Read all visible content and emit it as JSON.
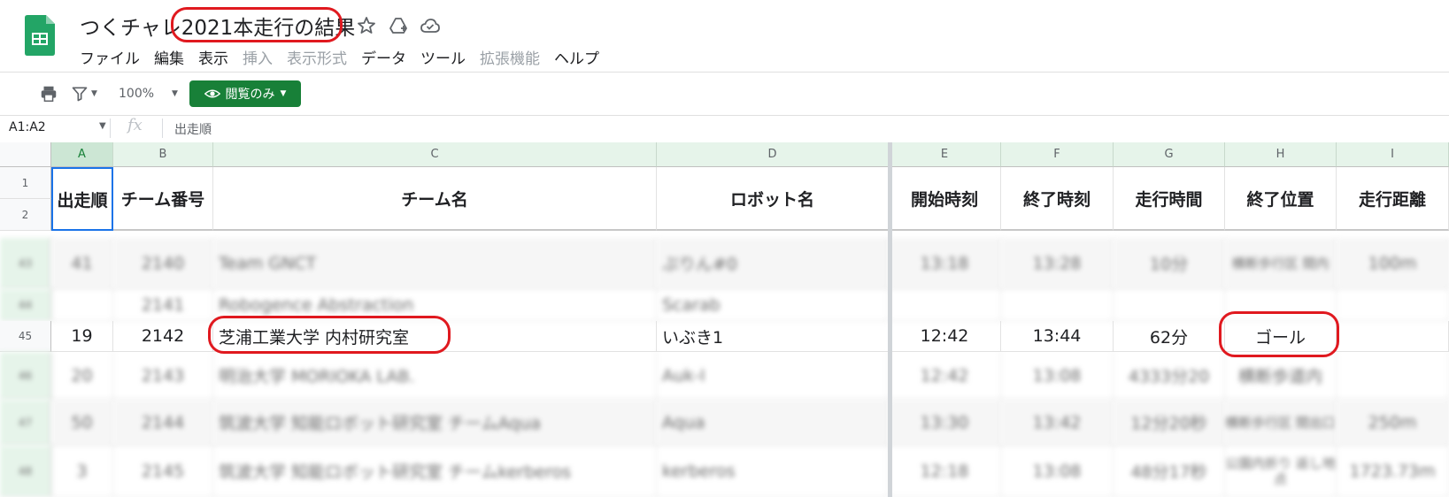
{
  "app": {
    "doc_title": "つくチャレ2021本走行の結果",
    "menu": [
      {
        "label": "ファイル",
        "enabled": true
      },
      {
        "label": "編集",
        "enabled": true
      },
      {
        "label": "表示",
        "enabled": true
      },
      {
        "label": "挿入",
        "enabled": false
      },
      {
        "label": "表示形式",
        "enabled": false
      },
      {
        "label": "データ",
        "enabled": true
      },
      {
        "label": "ツール",
        "enabled": true
      },
      {
        "label": "拡張機能",
        "enabled": false
      },
      {
        "label": "ヘルプ",
        "enabled": true
      }
    ]
  },
  "toolbar": {
    "zoom": "100%",
    "view_mode_label": "閲覧のみ"
  },
  "formula_bar": {
    "name_box": "A1:A2",
    "value": "出走順"
  },
  "grid": {
    "columns": [
      "A",
      "B",
      "C",
      "D",
      "E",
      "F",
      "G",
      "H",
      "I"
    ],
    "header_row_numbers": [
      "1",
      "2"
    ],
    "headers": [
      "出走順",
      "チーム番号",
      "チーム名",
      "ロボット名",
      "開始時刻",
      "終了時刻",
      "走行時間",
      "終了位置",
      "走行距離"
    ],
    "rows": [
      {
        "num": "43",
        "cells": [
          "41",
          "2140",
          "Team GNCT",
          "ぷりん#0",
          "13:18",
          "13:28",
          "10分",
          "横断歩行区 間内",
          "100m"
        ]
      },
      {
        "num": "44",
        "cells": [
          "",
          "2141",
          "Robogence Abstraction",
          "Scarab",
          "",
          "",
          "",
          "",
          ""
        ]
      },
      {
        "num": "45",
        "cells": [
          "19",
          "2142",
          "芝浦工業大学 内村研究室",
          "いぶき1",
          "12:42",
          "13:44",
          "62分",
          "ゴール",
          ""
        ]
      },
      {
        "num": "46",
        "cells": [
          "20",
          "2143",
          "明治大学 MORIOKA LAB.",
          "Auk-I",
          "12:42",
          "13:08",
          "4333分20",
          "横断歩道内",
          ""
        ]
      },
      {
        "num": "47",
        "cells": [
          "50",
          "2144",
          "筑波大学 知能ロボット研究室 チームAqua",
          "Aqua",
          "13:30",
          "13:42",
          "12分20秒",
          "横断歩行区 間出口",
          "250m"
        ]
      },
      {
        "num": "48",
        "cells": [
          "3",
          "2145",
          "筑波大学 知能ロボット研究室 チームkerberos",
          "kerberos",
          "12:18",
          "13:08",
          "48分17秒",
          "公園内折り 返し地点",
          "1723.73m"
        ]
      }
    ]
  },
  "colors": {
    "accent": "#188038",
    "highlight": "#e0191f"
  }
}
